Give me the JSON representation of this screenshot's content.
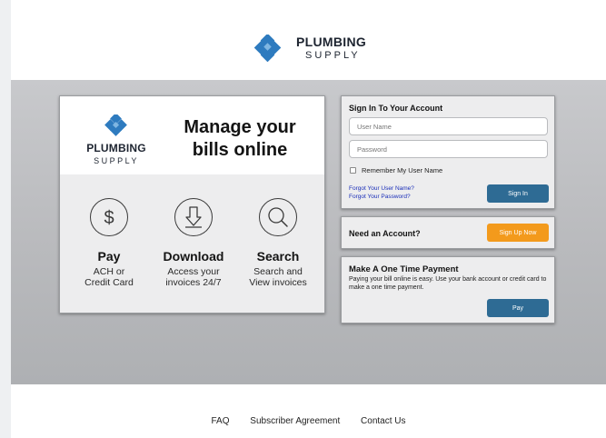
{
  "brand": {
    "line1": "PLUMBING",
    "line2": "SUPPLY",
    "color": "#2e7bbf"
  },
  "promo": {
    "title_line1": "Manage your",
    "title_line2": "bills online",
    "features": [
      {
        "icon": "dollar-icon",
        "title": "Pay",
        "desc_line1": "ACH or",
        "desc_line2": "Credit Card"
      },
      {
        "icon": "download-icon",
        "title": "Download",
        "desc_line1": "Access your",
        "desc_line2": "invoices 24/7"
      },
      {
        "icon": "search-icon",
        "title": "Search",
        "desc_line1": "Search and",
        "desc_line2": "View invoices"
      }
    ]
  },
  "signin": {
    "title": "Sign In To Your Account",
    "username_placeholder": "User Name",
    "password_placeholder": "Password",
    "remember_label": "Remember My User Name",
    "forgot_username": "Forgot Your User Name?",
    "forgot_password": "Forgot Your Password?",
    "button": "Sign In"
  },
  "signup": {
    "title": "Need an Account?",
    "button": "Sign Up Now"
  },
  "onetime": {
    "title": "Make A One Time Payment",
    "description": "Paying your bill online is easy. Use your bank account or credit card to make a one time payment.",
    "button": "Pay"
  },
  "footer": {
    "links": [
      "FAQ",
      "Subscriber Agreement",
      "Contact Us"
    ]
  },
  "colors": {
    "button_blue": "#2e6b94",
    "button_orange": "#f39a1c",
    "link_blue": "#1a2eb8"
  }
}
